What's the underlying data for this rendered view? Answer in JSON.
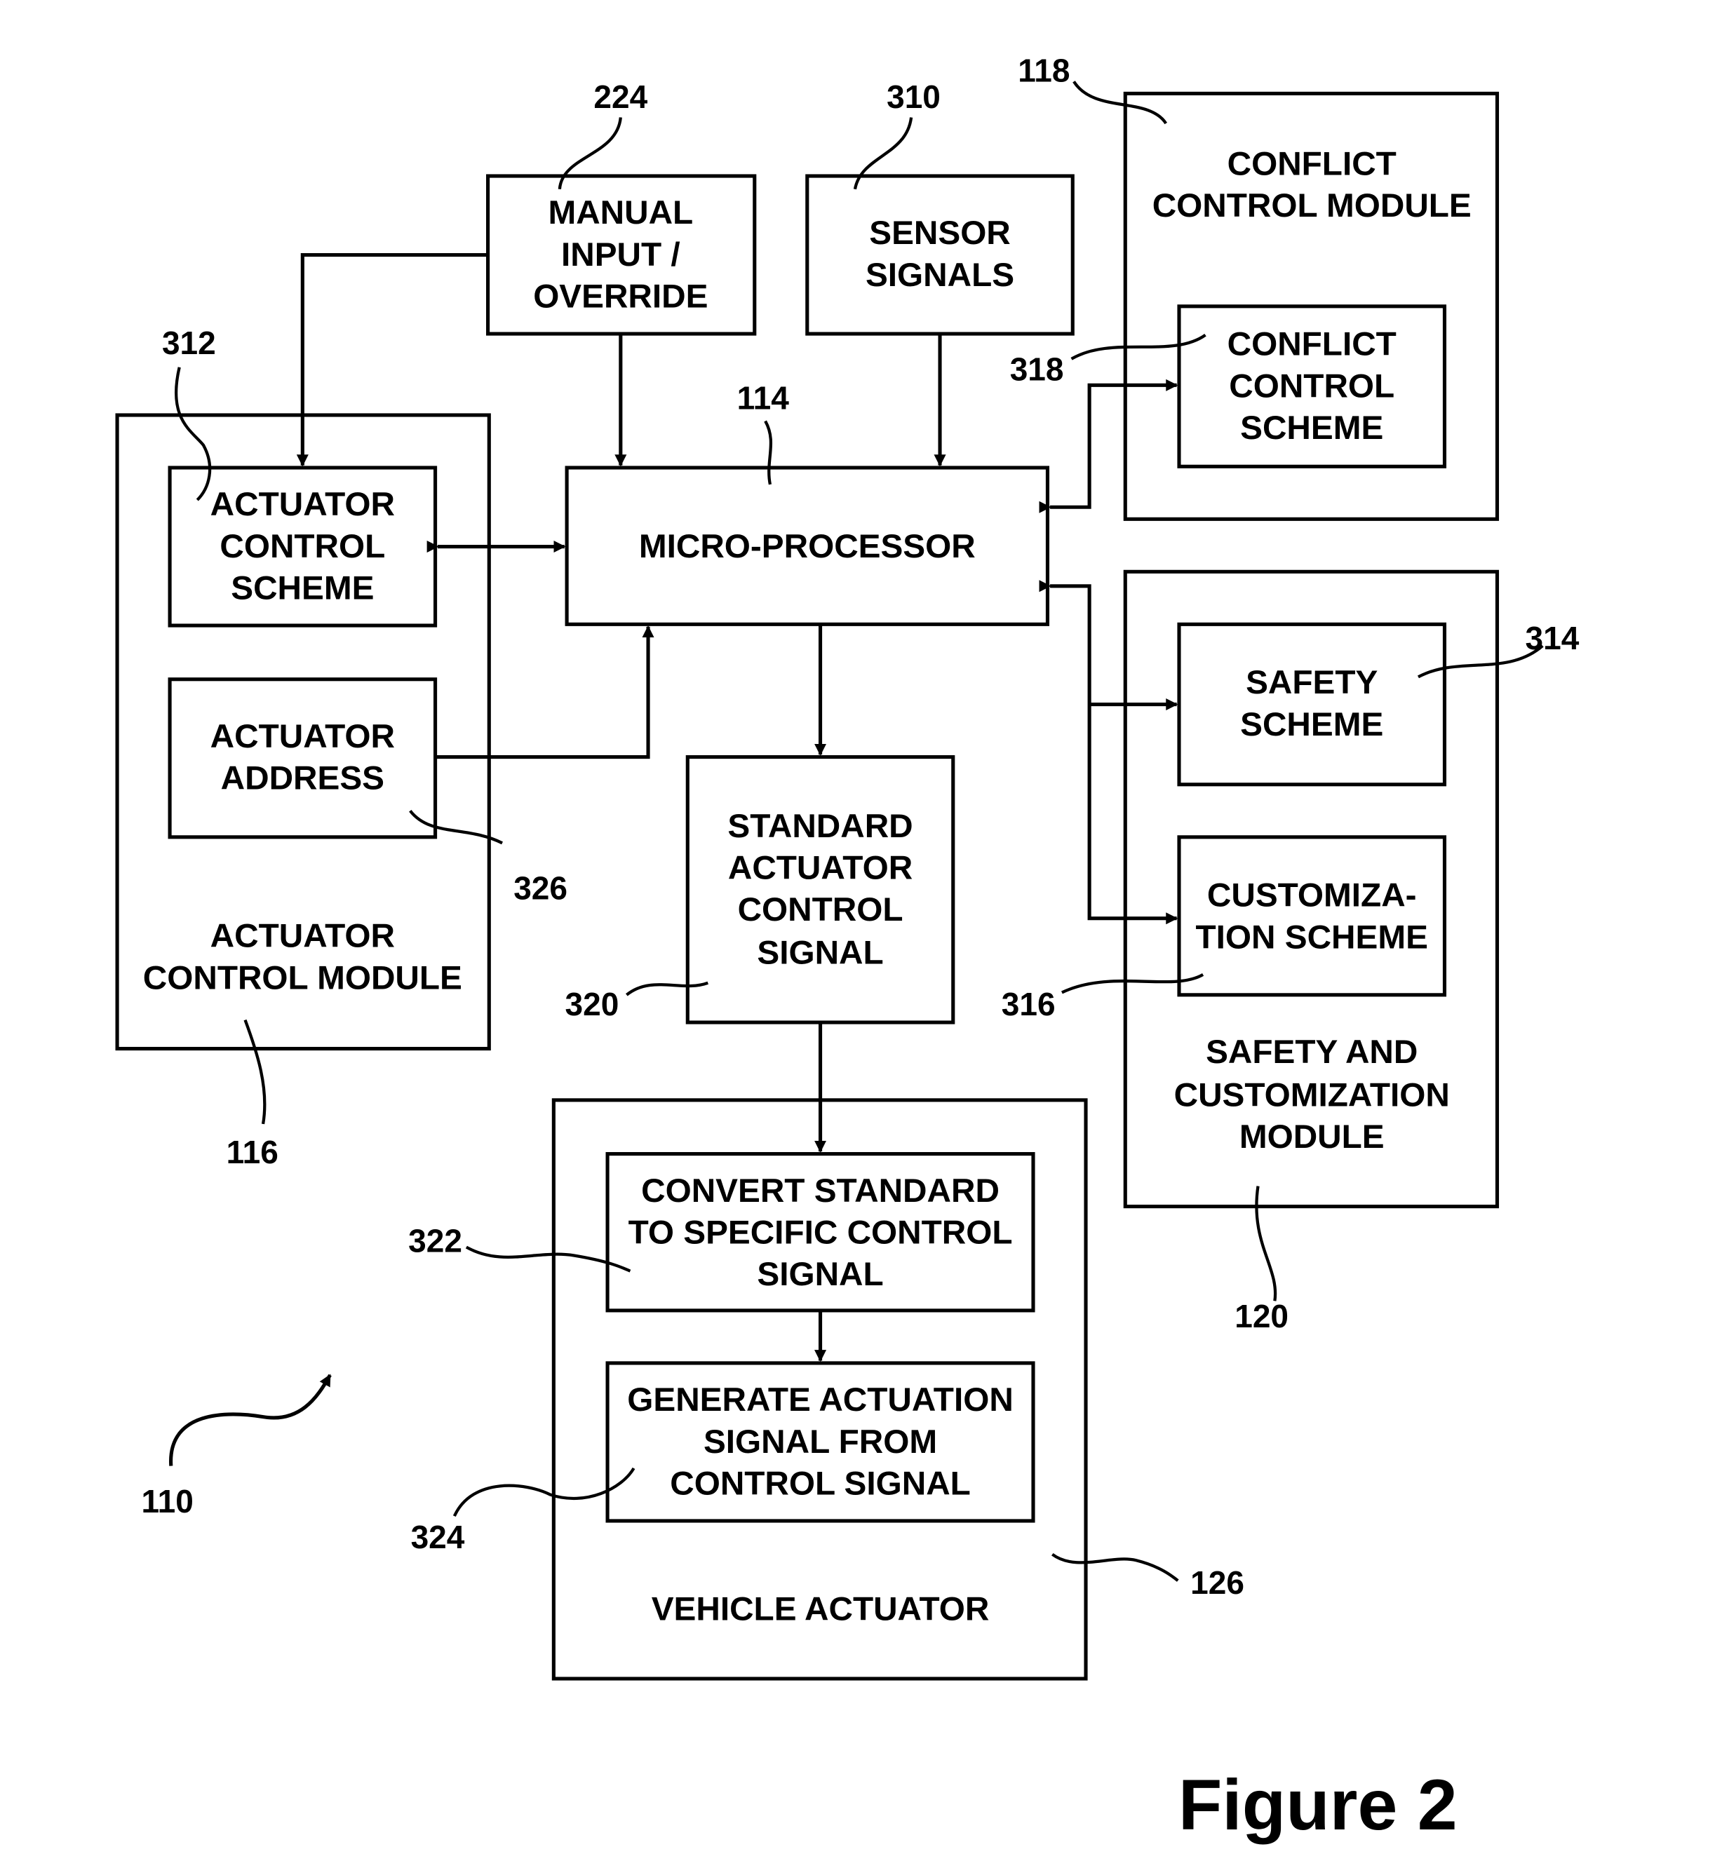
{
  "figure": {
    "title": "Figure 2",
    "system_ref": "110"
  },
  "blocks": {
    "manual_input": {
      "ref": "224",
      "lines": [
        "MANUAL",
        "INPUT /",
        "OVERRIDE"
      ]
    },
    "sensor_signals": {
      "ref": "310",
      "lines": [
        "SENSOR",
        "SIGNALS"
      ]
    },
    "conflict_module": {
      "ref": "118",
      "lines": [
        "CONFLICT",
        "CONTROL MODULE"
      ]
    },
    "conflict_scheme": {
      "ref": "318",
      "lines": [
        "CONFLICT",
        "CONTROL",
        "SCHEME"
      ]
    },
    "microprocessor": {
      "ref": "114",
      "lines": [
        "MICRO-PROCESSOR"
      ]
    },
    "actuator_module": {
      "ref": "116",
      "lines": [
        "ACTUATOR",
        "CONTROL MODULE"
      ]
    },
    "actuator_scheme": {
      "ref": "312",
      "lines": [
        "ACTUATOR",
        "CONTROL",
        "SCHEME"
      ]
    },
    "actuator_address": {
      "ref": "326",
      "lines": [
        "ACTUATOR",
        "ADDRESS"
      ]
    },
    "standard_signal": {
      "ref": "320",
      "lines": [
        "STANDARD",
        "ACTUATOR",
        "CONTROL",
        "SIGNAL"
      ]
    },
    "safety_module": {
      "ref": "120",
      "lines": [
        "SAFETY AND",
        "CUSTOMIZATION",
        "MODULE"
      ]
    },
    "safety_scheme": {
      "ref": "314",
      "lines": [
        "SAFETY",
        "SCHEME"
      ]
    },
    "custom_scheme": {
      "ref": "316",
      "lines": [
        "CUSTOMIZA-",
        "TION SCHEME"
      ]
    },
    "vehicle_actuator": {
      "ref": "126",
      "lines": [
        "VEHICLE ACTUATOR"
      ]
    },
    "convert": {
      "ref": "322",
      "lines": [
        "CONVERT STANDARD",
        "TO SPECIFIC CONTROL",
        "SIGNAL"
      ]
    },
    "generate": {
      "ref": "324",
      "lines": [
        "GENERATE ACTUATION",
        "SIGNAL FROM",
        "CONTROL SIGNAL"
      ]
    }
  }
}
